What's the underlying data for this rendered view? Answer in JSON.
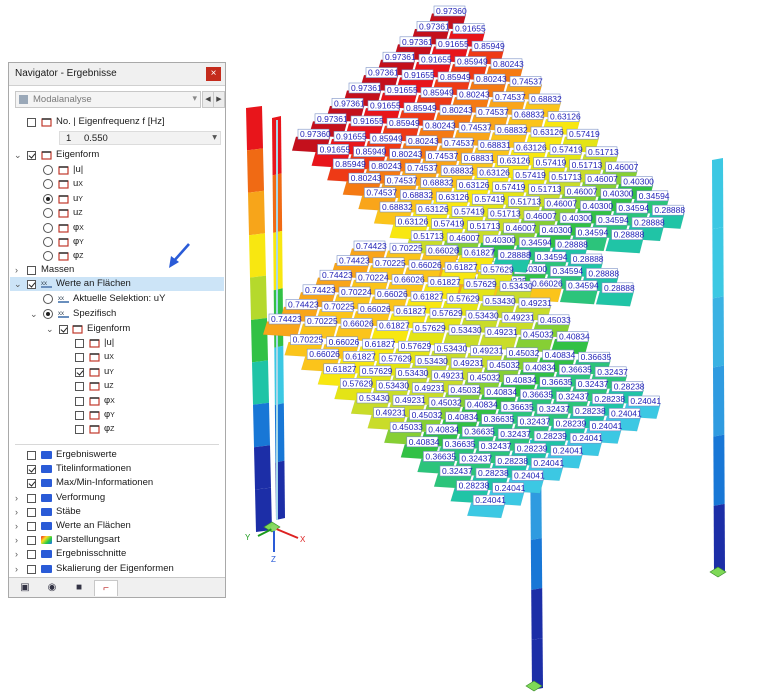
{
  "navigator": {
    "title": "Navigator - Ergebnisse",
    "close": "×",
    "combo": "Modalanalyse",
    "eigenfrequency_header": "No. | Eigenfrequenz f [Hz]",
    "mode_no": "1",
    "mode_freq": "0.550",
    "eigenform": {
      "label": "Eigenform",
      "options": [
        "|u|",
        "uX",
        "uY",
        "uZ",
        "φX",
        "φY",
        "φZ"
      ],
      "selected": "uY"
    },
    "massen": "Massen",
    "werte_an_flaechen": "Werte an Flächen",
    "aktuelle_selektion": "Aktuelle Selektion: uY",
    "spezifisch": "Spezifisch",
    "sub_eigenform": {
      "label": "Eigenform",
      "options": [
        "|u|",
        "uX",
        "uY",
        "uZ",
        "φX",
        "φY",
        "φZ"
      ],
      "checked": "uY"
    },
    "display_items": [
      {
        "label": "Ergebniswerte",
        "checked": false
      },
      {
        "label": "Titelinformationen",
        "checked": true
      },
      {
        "label": "Max/Min-Informationen",
        "checked": true
      },
      {
        "label": "Verformung",
        "checked": false
      },
      {
        "label": "Stäbe",
        "checked": false
      },
      {
        "label": "Werte an Flächen",
        "checked": false
      },
      {
        "label": "Darstellungsart",
        "checked": false
      },
      {
        "label": "Ergebnisschnitte",
        "checked": false
      },
      {
        "label": "Skalierung der Eigenformen",
        "checked": false
      }
    ],
    "tab_icons": [
      "view-icon",
      "eye-icon",
      "camera-icon",
      "results-icon"
    ]
  },
  "axes": {
    "x": "X",
    "y": "Y",
    "z": "Z"
  },
  "colors": {
    "red": "#e8151b",
    "dark_red": "#c4101c",
    "orange": "#f57a13",
    "light_orange": "#f9a51a",
    "yellow": "#f8e711",
    "yellow_green": "#c9dc2a",
    "green": "#32c145",
    "teal": "#20c4a6",
    "cyan": "#3cc8e3",
    "blue": "#1877d6",
    "dark_blue": "#1c2ea7",
    "label_text": "#2323b8"
  },
  "upper_roof_rows": [
    [
      "0.97360"
    ],
    [
      "0.97361",
      "0.91655"
    ],
    [
      "0.97361",
      "0.91655",
      "0.85949"
    ],
    [
      "0.97361",
      "0.91655",
      "0.85949",
      "0.80243"
    ],
    [
      "0.97361",
      "0.91655",
      "0.85949",
      "0.80243",
      "0.74537"
    ],
    [
      "0.97361",
      "0.91655",
      "0.85949",
      "0.80243",
      "0.74537",
      "0.68832"
    ],
    [
      "0.97361",
      "0.91655",
      "0.85949",
      "0.80243",
      "0.74537",
      "0.68832",
      "0.63126"
    ],
    [
      "0.97361",
      "0.91655",
      "0.85949",
      "0.80243",
      "0.74537",
      "0.68832",
      "0.63126",
      "0.57419"
    ],
    [
      "0.97360",
      "0.91655",
      "0.85949",
      "0.80243",
      "0.74537",
      "0.68831",
      "0.63126",
      "0.57419",
      "0.51713"
    ],
    [
      "0.91655",
      "0.85949",
      "0.80243",
      "0.74537",
      "0.68831",
      "0.63126",
      "0.57419",
      "0.51713",
      "0.46007"
    ],
    [
      "0.85949",
      "0.80243",
      "0.74537",
      "0.68832",
      "0.63126",
      "0.57419",
      "0.51713",
      "0.46007",
      "0.40300"
    ],
    [
      "0.80243",
      "0.74537",
      "0.68832",
      "0.63126",
      "0.57419",
      "0.51713",
      "0.46007",
      "0.40300",
      "0.34594"
    ],
    [
      "0.74537",
      "0.68832",
      "0.63126",
      "0.57419",
      "0.51713",
      "0.46007",
      "0.40300",
      "0.34594",
      "0.28888"
    ],
    [
      "0.68832",
      "0.63126",
      "0.57419",
      "0.51713",
      "0.46007",
      "0.40300",
      "0.34594",
      "0.28888"
    ],
    [
      "0.63126",
      "0.57419",
      "0.51713",
      "0.46007",
      "0.40300",
      "0.34594",
      "0.28888"
    ],
    [
      "0.51713",
      "0.46007",
      "0.40300",
      "0.34594",
      "0.28888"
    ],
    [
      "0.74423",
      "0.46007",
      "0.40300",
      "0.34594",
      "0.28888"
    ],
    [
      "0.74423",
      "0.70225",
      "0.40300",
      "0.34594",
      "0.28888"
    ],
    [
      "0.74423",
      "0.70225",
      "0.66026",
      "0.34594",
      "0.28888"
    ]
  ],
  "lower_roof_rows": [
    [
      "0.74423",
      "0.70225",
      "0.66026",
      "0.61827",
      "0.28888"
    ],
    [
      "0.74423",
      "0.70225",
      "0.66026",
      "0.61827",
      "0.57629"
    ],
    [
      "0.74423",
      "0.70224",
      "0.66026",
      "0.61827",
      "0.57629",
      "0.53430"
    ],
    [
      "0.74423",
      "0.70224",
      "0.66026",
      "0.61827",
      "0.57629",
      "0.53430",
      "0.49231"
    ],
    [
      "0.74423",
      "0.70225",
      "0.66026",
      "0.61827",
      "0.57629",
      "0.53430",
      "0.49231",
      "0.45033"
    ],
    [
      "0.74423",
      "0.70225",
      "0.66026",
      "0.61827",
      "0.57629",
      "0.53430",
      "0.49231",
      "0.45032",
      "0.40834"
    ],
    [
      "0.70225",
      "0.66026",
      "0.61827",
      "0.57629",
      "0.53430",
      "0.49231",
      "0.45032",
      "0.40834",
      "0.36635"
    ],
    [
      "0.66026",
      "0.61827",
      "0.57629",
      "0.53430",
      "0.49231",
      "0.45032",
      "0.40834",
      "0.36635",
      "0.32437"
    ],
    [
      "0.61827",
      "0.57629",
      "0.53430",
      "0.49231",
      "0.45032",
      "0.40834",
      "0.36635",
      "0.32437",
      "0.28238"
    ],
    [
      "0.57629",
      "0.53430",
      "0.49231",
      "0.45032",
      "0.40834",
      "0.36635",
      "0.32437",
      "0.28238",
      "0.24041"
    ],
    [
      "0.53430",
      "0.49231",
      "0.45032",
      "0.40834",
      "0.36635",
      "0.32437",
      "0.28238",
      "0.24041"
    ],
    [
      "0.49231",
      "0.45032",
      "0.40834",
      "0.36635",
      "0.32437",
      "0.28239",
      "0.24041"
    ],
    [
      "0.45033",
      "0.40834",
      "0.36635",
      "0.32437",
      "0.28239",
      "0.24041"
    ],
    [
      "0.40834",
      "0.36635",
      "0.32437",
      "0.28239",
      "0.24041"
    ],
    [
      "0.36635",
      "0.32437",
      "0.28238",
      "0.24041"
    ],
    [
      "0.32437",
      "0.28238",
      "0.24041"
    ],
    [
      "0.28238",
      "0.24041"
    ],
    [
      "0.24041"
    ]
  ]
}
